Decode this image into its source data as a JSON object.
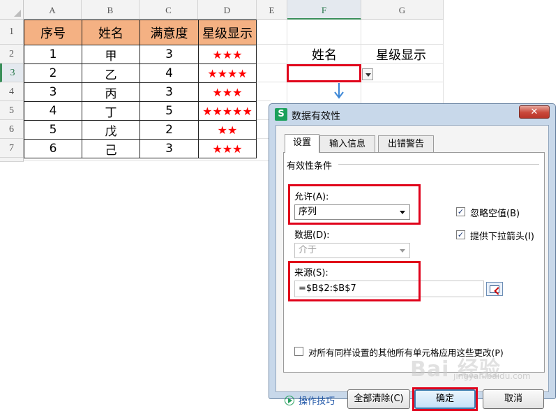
{
  "sheet": {
    "columns": [
      "A",
      "B",
      "C",
      "D",
      "E",
      "F",
      "G"
    ],
    "rows": [
      "1",
      "2",
      "3",
      "4",
      "5",
      "6",
      "7"
    ],
    "table_headers": [
      "序号",
      "姓名",
      "满意度",
      "星级显示"
    ],
    "table_rows": [
      [
        "1",
        "甲",
        "3",
        "★★★"
      ],
      [
        "2",
        "乙",
        "4",
        "★★★★"
      ],
      [
        "3",
        "丙",
        "3",
        "★★★"
      ],
      [
        "4",
        "丁",
        "5",
        "★★★★★"
      ],
      [
        "5",
        "戊",
        "2",
        "★★"
      ],
      [
        "6",
        "己",
        "3",
        "★★★"
      ]
    ],
    "f2_label": "姓名",
    "g2_label": "星级显示",
    "header_fill": "#f4b183",
    "star_color": "#ff0000"
  },
  "dialog": {
    "title": "数据有效性",
    "app_icon": "S",
    "close_symbol": "✕",
    "tabs": [
      "设置",
      "输入信息",
      "出错警告"
    ],
    "group_label": "有效性条件",
    "allow_label": "允许(A):",
    "allow_value": "序列",
    "data_label": "数据(D):",
    "data_value": "介于",
    "source_label": "来源(S):",
    "source_value": "=$B$2:$B$7",
    "ignore_blank_label": "忽略空值(B)",
    "dropdown_label": "提供下拉箭头(I)",
    "apply_all_label": "对所有同样设置的其他所有单元格应用这些更改(P)",
    "tips_label": "操作技巧",
    "clear_all_label": "全部清除(C)",
    "ok_label": "确定",
    "cancel_label": "取消",
    "highlight_color": "#e0001a"
  },
  "watermark": {
    "text": "Bai 经验",
    "sub": "jingyan.baidu.com"
  }
}
